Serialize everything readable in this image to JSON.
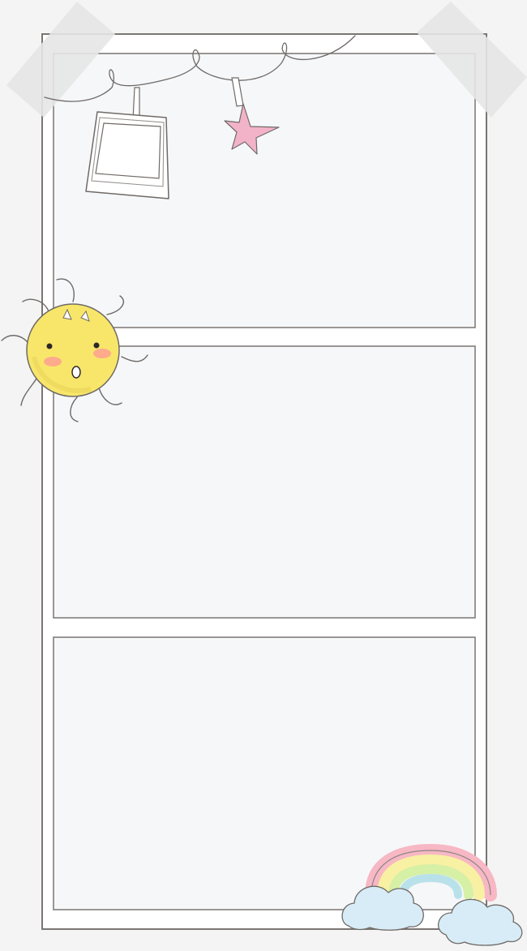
{
  "scene": {
    "kind": "decorative-photo-frame-template",
    "panels_count": 3,
    "decorations": [
      "tape",
      "string-line",
      "hanging-polaroid",
      "hanging-star",
      "sun-face",
      "rainbow",
      "clouds"
    ]
  },
  "colors": {
    "background": "#f4f4f4",
    "frame_fill": "#ffffff",
    "frame_line": "#7a7572",
    "panel_fill": "#f6f7f9",
    "tape": "#e6e6e6",
    "sun_yellow": "#f8e66a",
    "sun_blush": "#ff9f93",
    "star_pink": "#f2b3c8",
    "rainbow_pink": "#f7b7c4",
    "rainbow_yellow": "#f8f0a2",
    "rainbow_green": "#d6f0a6",
    "rainbow_blue": "#b9e1ea",
    "cloud_blue": "#d7ecf6"
  }
}
